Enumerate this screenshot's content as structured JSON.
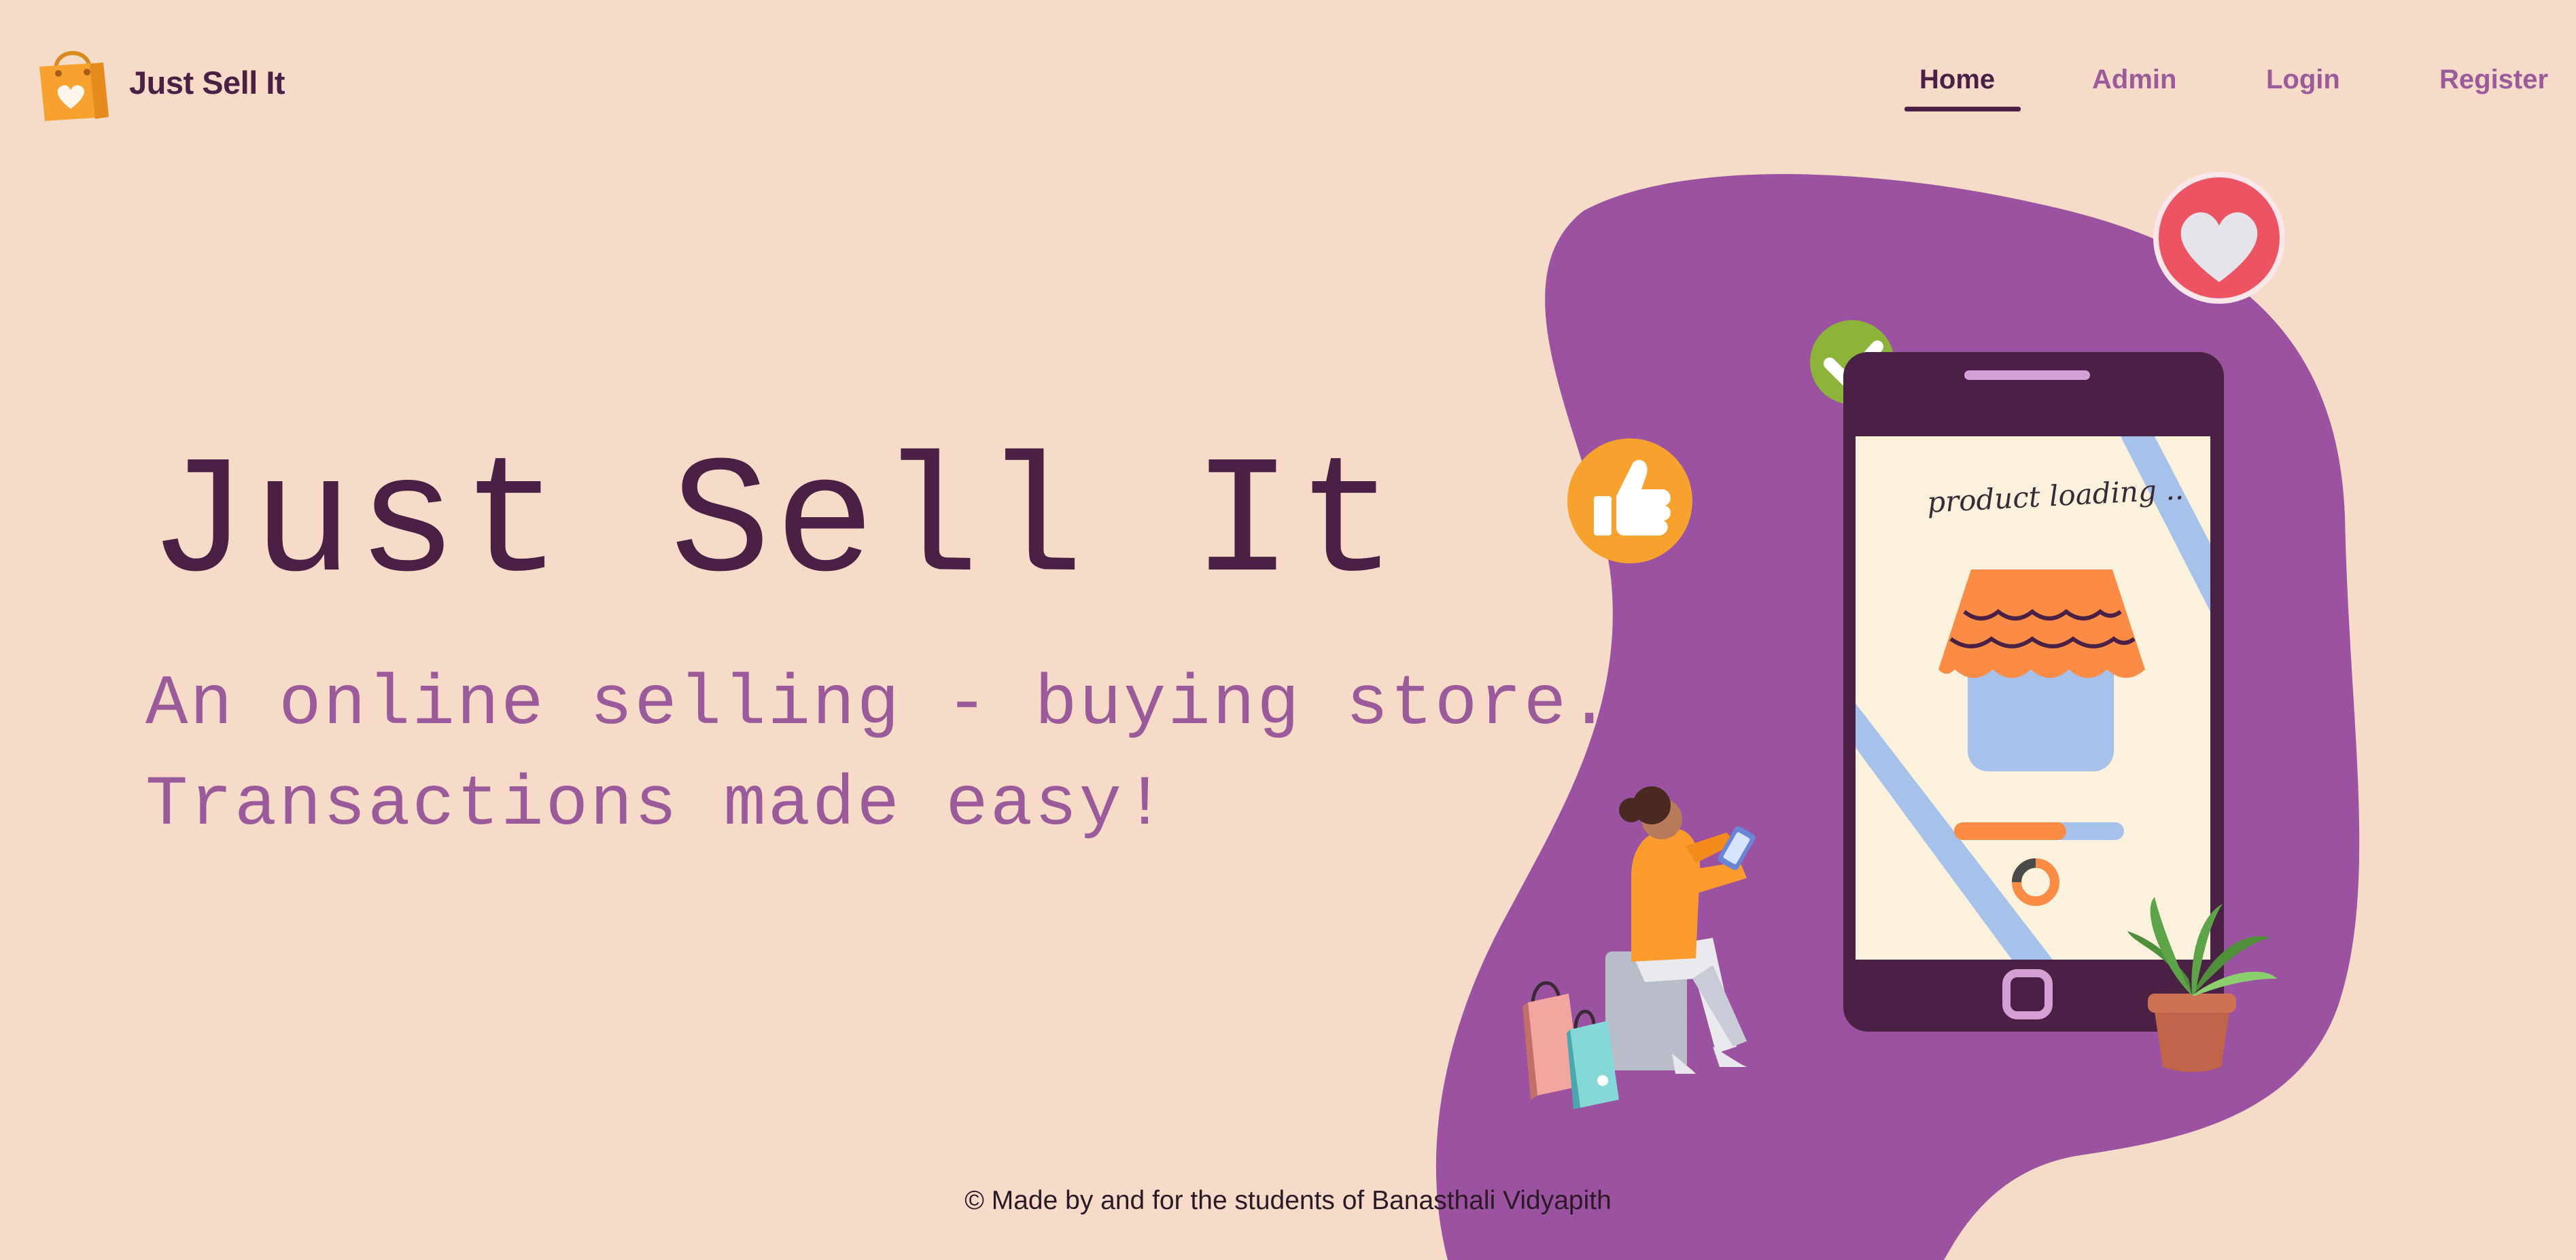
{
  "brand": {
    "name": "Just Sell It",
    "logo_icon": "shopping-bag-heart-icon"
  },
  "nav": {
    "items": [
      {
        "label": "Home",
        "active": true
      },
      {
        "label": "Admin",
        "active": false
      },
      {
        "label": "Login",
        "active": false
      },
      {
        "label": "Register",
        "active": false
      }
    ]
  },
  "hero": {
    "title": "Just Sell It",
    "subtitle_line1": "An online selling - buying store.",
    "subtitle_line2": "Transactions made easy!"
  },
  "illustration": {
    "phone_screen_text": "product loading ..",
    "icons": [
      "heart-icon",
      "checkmark-icon",
      "thumbs-up-icon",
      "storefront-icon",
      "plant-icon",
      "shopping-bags-icon"
    ]
  },
  "footer": {
    "text": "© Made by and for the students of Banasthali Vidyapith"
  },
  "colors": {
    "background": "#f5dbc8",
    "primary_dark": "#4a2145",
    "accent_purple": "#9b5a9a",
    "blob": "#9a52a1",
    "heart_red": "#ec5464",
    "check_green": "#8cb33a",
    "thumb_orange": "#f7a12f"
  }
}
